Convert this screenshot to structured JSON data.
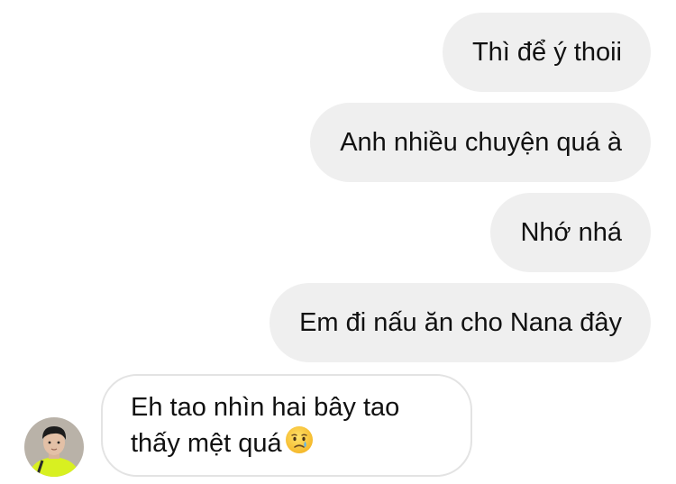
{
  "messages": [
    {
      "direction": "sent",
      "text": "Thì để ý thoii"
    },
    {
      "direction": "sent",
      "text": "Anh nhiều chuyện quá à"
    },
    {
      "direction": "sent",
      "text": "Nhớ nhá"
    },
    {
      "direction": "sent",
      "text": "Em đi nấu ăn cho Nana đây"
    },
    {
      "direction": "received",
      "line1": "Eh tao nhìn hai bây tao",
      "line2": "thấy mệt quá",
      "emoji": "crying-face-icon"
    }
  ],
  "colors": {
    "sent_bubble": "#efefef",
    "received_border": "#e3e3e3",
    "text": "#111111",
    "avatar_shirt": "#d8f021"
  }
}
